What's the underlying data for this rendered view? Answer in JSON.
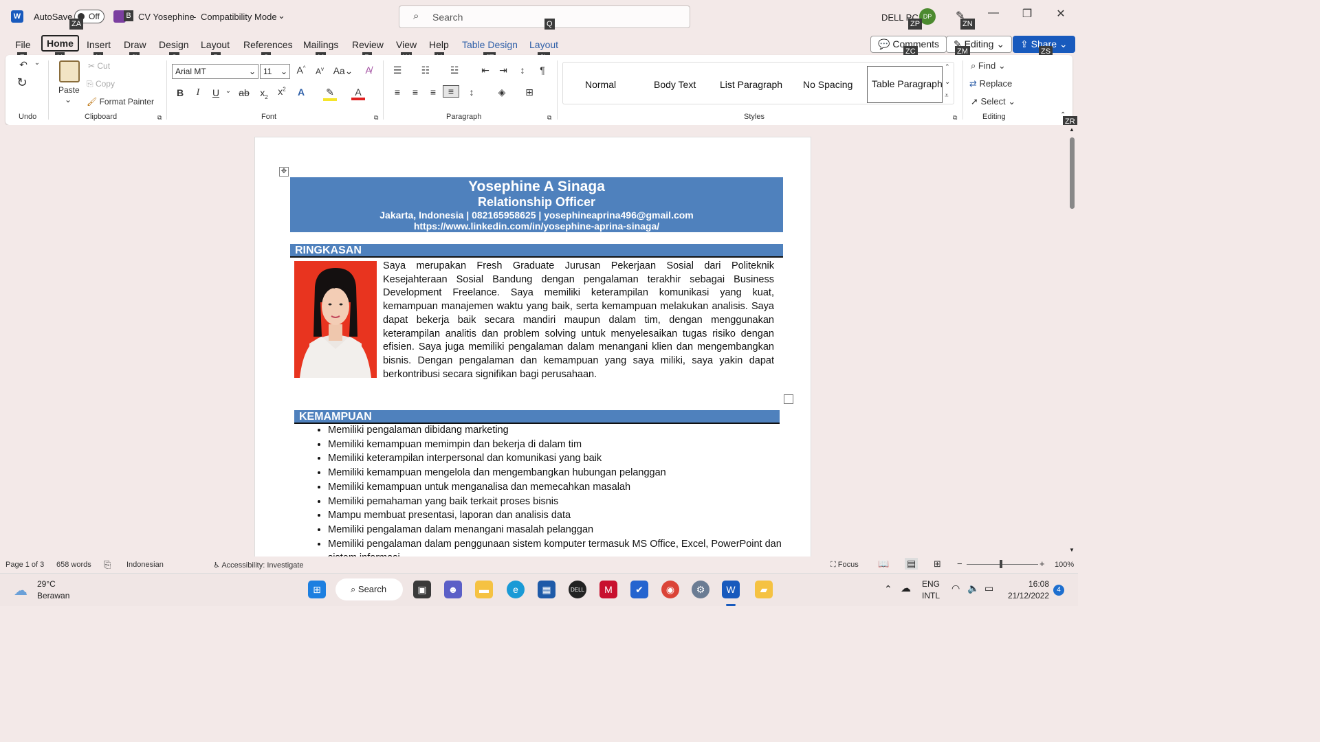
{
  "titlebar": {
    "autosave_label": "AutoSave",
    "autosave_state": "Off",
    "doc_title": "CV Yosephine",
    "separator": "-",
    "mode": "Compatibility Mode",
    "search_placeholder": "Search",
    "user": "DELL PC",
    "avatar_initials": "DP",
    "minimize": "—",
    "restore": "❐",
    "close": "✕"
  },
  "keytips": {
    "autosave": "ZA",
    "file_badge": "B",
    "search": "Q",
    "user": "ZP",
    "cap": "ZN",
    "file": "F",
    "home": "H",
    "insert": "N",
    "draw": "JI",
    "design": "G",
    "layout": "P",
    "references": "S",
    "mailings": "M",
    "review": "R",
    "view": "W",
    "help": "Y",
    "table_design": "JT",
    "table_layout": "JL",
    "comments": "ZC",
    "editing": "ZM",
    "share": "ZS",
    "collapse": "ZR"
  },
  "tabs": {
    "file": "File",
    "home": "Home",
    "insert": "Insert",
    "draw": "Draw",
    "design": "Design",
    "layout": "Layout",
    "references": "References",
    "mailings": "Mailings",
    "review": "Review",
    "view": "View",
    "help": "Help",
    "table_design": "Table Design",
    "table_layout": "Layout"
  },
  "top_buttons": {
    "comments": "Comments",
    "editing": "Editing",
    "share": "Share"
  },
  "ribbon": {
    "undo_group": "Undo",
    "paste": "Paste",
    "cut": "Cut",
    "copy": "Copy",
    "format_painter": "Format Painter",
    "clipboard_group": "Clipboard",
    "font_name": "Arial MT",
    "font_size": "11",
    "font_group": "Font",
    "paragraph_group": "Paragraph",
    "styles": [
      "Normal",
      "Body Text",
      "List Paragraph",
      "No Spacing",
      "Table Paragraph"
    ],
    "styles_group": "Styles",
    "find": "Find",
    "replace": "Replace",
    "select": "Select",
    "editing_group": "Editing"
  },
  "document": {
    "name": "Yosephine A Sinaga",
    "role": "Relationship Officer",
    "contact": "Jakarta, Indonesia | 082165958625 | yosephineaprina496@gmail.com",
    "linkedin": "https://www.linkedin.com/in/yosephine-aprina-sinaga/",
    "section_summary": "RINGKASAN",
    "summary": "Saya merupakan Fresh Graduate Jurusan Pekerjaan Sosial dari Politeknik Kesejahteraan Sosial Bandung dengan pengalaman terakhir sebagai Business Development Freelance. Saya memiliki keterampilan komunikasi yang kuat, kemampuan manajemen waktu yang baik, serta kemampuan melakukan analisis. Saya dapat bekerja baik secara mandiri maupun dalam tim, dengan menggunakan keterampilan analitis dan problem solving untuk menyelesaikan tugas risiko dengan efisien. Saya juga memiliki pengalaman dalam menangani klien dan mengembangkan bisnis. Dengan pengalaman dan kemampuan yang saya  miliki, saya yakin dapat berkontribusi secara signifikan bagi perusahaan.",
    "section_skills": "KEMAMPUAN",
    "skills": [
      "Memiliki pengalaman dibidang marketing",
      "Memiliki kemampuan memimpin dan bekerja di dalam tim",
      "Memiliki keterampilan interpersonal dan komunikasi yang baik",
      "Memiliki kemampuan mengelola dan mengembangkan hubungan pelanggan",
      "Memiliki kemampuan untuk menganalisa dan memecahkan masalah",
      "Memiliki pemahaman yang baik terkait proses bisnis",
      "Mampu membuat presentasi, laporan dan analisis data",
      "Memiliki pengalaman dalam menangani masalah pelanggan",
      "Memiliki pengalaman dalam penggunaan sistem komputer termasuk MS Office, Excel, PowerPoint dan sistem informasi"
    ]
  },
  "statusbar": {
    "page": "Page 1 of 3",
    "words": "658 words",
    "language": "Indonesian",
    "accessibility": "Accessibility: Investigate",
    "focus": "Focus",
    "zoom_minus": "−",
    "zoom_plus": "+",
    "zoom": "100%"
  },
  "taskbar": {
    "temp": "29°C",
    "weather": "Berawan",
    "search": "Search",
    "lang1": "ENG",
    "lang2": "INTL",
    "time": "16:08",
    "date": "21/12/2022",
    "badge": "4"
  },
  "colors": {
    "accent": "#185abd",
    "heading_band": "#4f81bd",
    "photo_bg": "#e8341f"
  }
}
